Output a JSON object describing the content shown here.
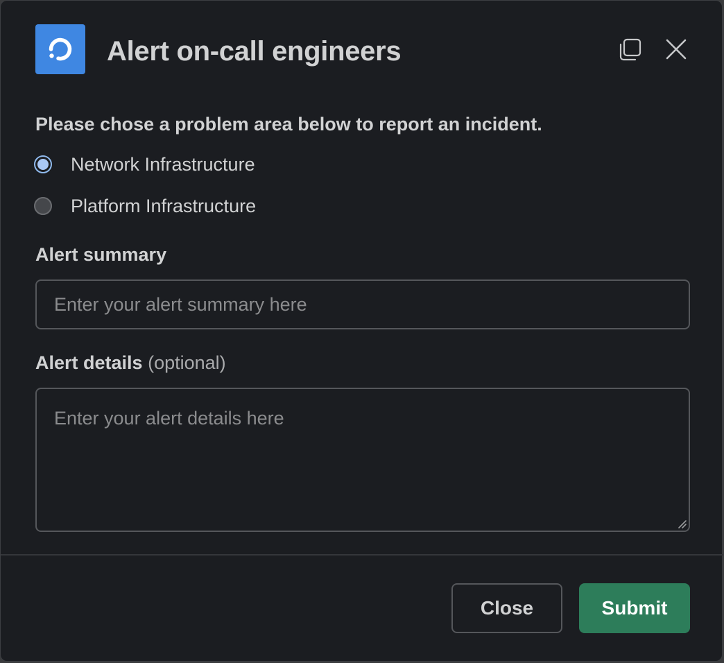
{
  "modal": {
    "title": "Alert on-call engineers",
    "app_icon": "refresh-icon",
    "copy_icon": "copy-icon",
    "close_icon": "close-icon"
  },
  "form": {
    "prompt": "Please chose a problem area below to report an incident.",
    "options": [
      {
        "label": "Network Infrastructure",
        "selected": true
      },
      {
        "label": "Platform Infrastructure",
        "selected": false
      }
    ],
    "summary": {
      "label": "Alert summary",
      "placeholder": "Enter your alert summary here",
      "value": ""
    },
    "details": {
      "label": "Alert details",
      "optional": "(optional)",
      "placeholder": "Enter your alert details here",
      "value": ""
    }
  },
  "footer": {
    "close_label": "Close",
    "submit_label": "Submit"
  },
  "colors": {
    "background": "#1b1d21",
    "accent": "#3f87e2",
    "submit": "#2d7d5a",
    "text": "#d1d2d3"
  }
}
